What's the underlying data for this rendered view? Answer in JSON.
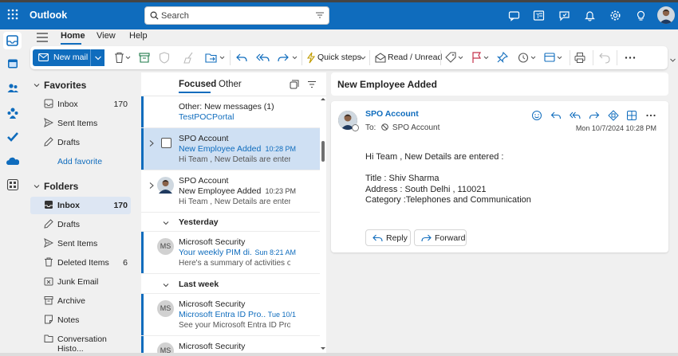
{
  "app": {
    "title": "Outlook"
  },
  "search": {
    "placeholder": "Search"
  },
  "topbar_icons": [
    "meet-now-icon",
    "teams-icon",
    "whats-new-icon",
    "bell-icon",
    "settings-icon",
    "tips-icon"
  ],
  "ribbon_tabs": [
    {
      "label": "Home"
    },
    {
      "label": "View"
    },
    {
      "label": "Help"
    }
  ],
  "ribbon": {
    "new_mail": "New mail",
    "quick_steps": "Quick steps",
    "read_unread": "Read / Unread"
  },
  "favorites": {
    "header": "Favorites",
    "items": [
      {
        "label": "Inbox",
        "count": "170",
        "icon": "inbox-icon"
      },
      {
        "label": "Sent Items",
        "count": "",
        "icon": "send-icon"
      },
      {
        "label": "Drafts",
        "count": "",
        "icon": "pencil-icon"
      }
    ],
    "add": "Add favorite"
  },
  "folders": {
    "header": "Folders",
    "items": [
      {
        "label": "Inbox",
        "count": "170",
        "icon": "inbox-icon"
      },
      {
        "label": "Drafts",
        "count": "",
        "icon": "pencil-icon"
      },
      {
        "label": "Sent Items",
        "count": "",
        "icon": "send-icon"
      },
      {
        "label": "Deleted Items",
        "count": "6",
        "icon": "trash-icon"
      },
      {
        "label": "Junk Email",
        "count": "",
        "icon": "junk-icon"
      },
      {
        "label": "Archive",
        "count": "",
        "icon": "archive-icon"
      },
      {
        "label": "Notes",
        "count": "",
        "icon": "note-icon"
      },
      {
        "label": "Conversation Histo...",
        "count": "",
        "icon": "folder-icon"
      }
    ]
  },
  "list": {
    "tabs": {
      "focused": "Focused",
      "other": "Other"
    },
    "other_notice": {
      "line1": "Other: New messages (1)",
      "line2": "TestPOCPortal"
    },
    "messages": [
      {
        "from": "SPO Account",
        "subject": "New Employee Added",
        "time": "10:28 PM",
        "preview": "Hi Team , New Details are entere..."
      },
      {
        "from": "SPO Account",
        "subject": "New Employee Added",
        "time": "10:23 PM",
        "preview": "Hi Team , New Details are entere..."
      }
    ],
    "group_yesterday": "Yesterday",
    "yesterday": [
      {
        "initials": "MS",
        "from": "Microsoft Security",
        "subject": "Your weekly PIM di...",
        "time": "Sun 8:21 AM",
        "preview": "Here's a summary of activities ov..."
      }
    ],
    "group_lastweek": "Last week",
    "lastweek": [
      {
        "initials": "MS",
        "from": "Microsoft Security",
        "subject": "Microsoft Entra ID Pro...",
        "time": "Tue 10/1",
        "preview": "See your Microsoft Entra ID Prot..."
      },
      {
        "initials": "MS",
        "from": "Microsoft Security"
      }
    ]
  },
  "reading": {
    "subject": "New Employee Added",
    "sender": "SPO Account",
    "to_label": "To:",
    "to": "SPO Account",
    "date": "Mon 10/7/2024 10:28 PM",
    "body": [
      "Hi Team , New Details are entered :",
      "",
      "Title : Shiv Sharma",
      "Address : South Delhi , 110021",
      "Category :Telephones and Communication"
    ],
    "reply": "Reply",
    "forward": "Forward"
  }
}
